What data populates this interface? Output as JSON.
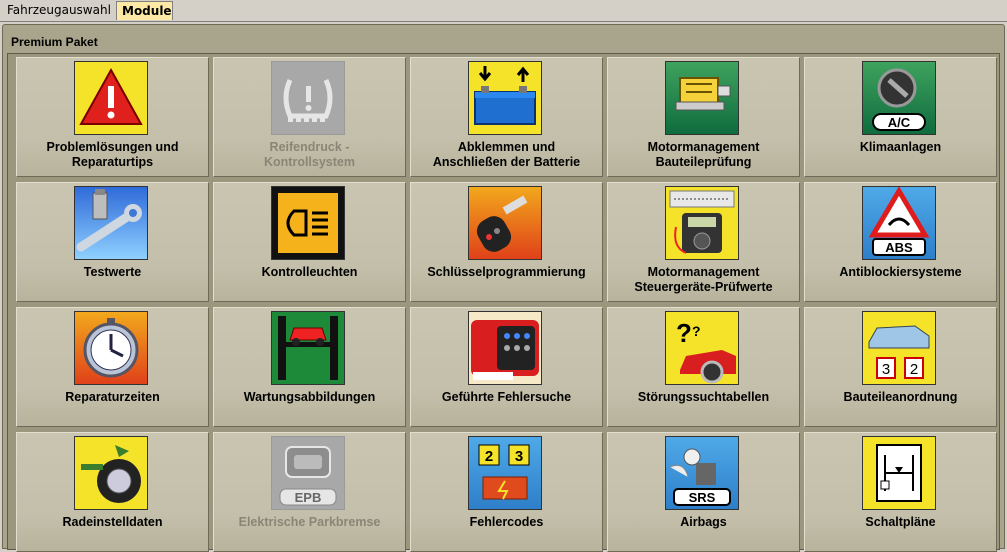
{
  "tabs": [
    {
      "label": "Fahrzeugauswahl",
      "active": false
    },
    {
      "label": "Module",
      "active": true
    }
  ],
  "panel": {
    "title": "Premium Paket"
  },
  "modules": [
    {
      "label": "Problemlösungen und\nReparaturtips",
      "icon": "warning-triangle-icon",
      "enabled": true
    },
    {
      "label": "Reifendruck -\nKontrollsystem",
      "icon": "tire-pressure-icon",
      "enabled": false
    },
    {
      "label": "Abklemmen und\nAnschließen der Batterie",
      "icon": "battery-icon",
      "enabled": true
    },
    {
      "label": "Motormanagement\nBauteileprüfung",
      "icon": "engine-component-icon",
      "enabled": true
    },
    {
      "label": "Klimaanlagen",
      "icon": "air-conditioning-icon",
      "icon_text": "A/C",
      "enabled": true
    },
    {
      "label": "Testwerte",
      "icon": "wrench-icon",
      "enabled": true
    },
    {
      "label": "Kontrolleuchten",
      "icon": "warning-lamp-icon",
      "enabled": true
    },
    {
      "label": "Schlüsselprogrammierung",
      "icon": "car-key-icon",
      "enabled": true
    },
    {
      "label": "Motormanagement\nSteuergeräte-Prüfwerte",
      "icon": "multimeter-icon",
      "enabled": true
    },
    {
      "label": "Antiblockiersysteme",
      "icon": "abs-icon",
      "icon_text": "ABS",
      "enabled": true
    },
    {
      "label": "Reparaturzeiten",
      "icon": "stopwatch-icon",
      "enabled": true
    },
    {
      "label": "Wartungsabbildungen",
      "icon": "car-lift-icon",
      "enabled": true
    },
    {
      "label": "Geführte Fehlersuche",
      "icon": "diagnostic-tester-icon",
      "enabled": true
    },
    {
      "label": "Störungssuchtabellen",
      "icon": "question-car-icon",
      "enabled": true
    },
    {
      "label": "Bauteileanordnung",
      "icon": "car-layout-icon",
      "icon_text": [
        "3",
        "2"
      ],
      "enabled": true
    },
    {
      "label": "Radeinstelldaten",
      "icon": "wheel-alignment-icon",
      "enabled": true
    },
    {
      "label": "Elektrische Parkbremse",
      "icon": "parking-brake-icon",
      "icon_text": "EPB",
      "enabled": false
    },
    {
      "label": "Fehlercodes",
      "icon": "fault-codes-icon",
      "icon_text": [
        "2",
        "3"
      ],
      "enabled": true
    },
    {
      "label": "Airbags",
      "icon": "airbag-icon",
      "icon_text": "SRS",
      "enabled": true
    },
    {
      "label": "Schaltpläne",
      "icon": "wiring-diagram-icon",
      "enabled": true
    }
  ]
}
